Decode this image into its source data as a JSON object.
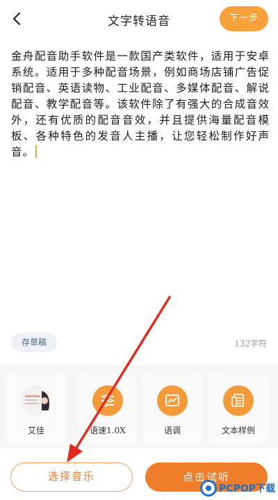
{
  "header": {
    "back_icon": "chevron-left-icon",
    "title": "文字转语音",
    "next_label": "下一步"
  },
  "editor": {
    "text": "金舟配音助手软件是一款国产类软件，适用于安卓系统。适用于多种配音场景，例如商场店铺广告促销配音、英语读物、工业配音、多媒体配音、解说配音、教学配音等。该软件除了有强大的合成音效外，还有优质的配音音效，并且提供海量配音模板、各种特色的发音人主播，让您轻松制作好声音。"
  },
  "draft": {
    "label": "存草稿"
  },
  "char_count": "132字符",
  "tools": [
    {
      "label": "艾佳",
      "icon": "anchor-avatar"
    },
    {
      "label": "语速1.0X",
      "icon": "speed-icon"
    },
    {
      "label": "语调",
      "icon": "tone-chart-icon"
    },
    {
      "label": "文本样例",
      "icon": "document-icon"
    }
  ],
  "bottom": {
    "pick_music_label": "选择音乐",
    "listen_label": "点击试听"
  },
  "watermark": {
    "text": "PCPOP下载"
  },
  "colors": {
    "accent": "#f6a13a",
    "primary_button": "#f07d2a",
    "annotation_arrow": "#e02b20"
  }
}
